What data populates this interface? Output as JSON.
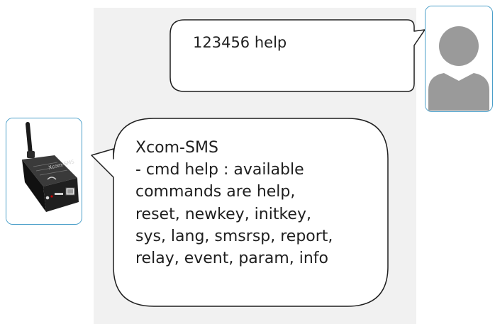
{
  "conversation": {
    "user_message": "123456 help",
    "device_reply": {
      "lines": [
        "Xcom-SMS",
        "- cmd help : available",
        "commands are help,",
        "reset, newkey, initkey,",
        "sys, lang, smsrsp, report,",
        "relay, event, param, info"
      ]
    }
  },
  "device_label": "Xcom-SMS",
  "icons": {
    "user": "person-avatar-icon",
    "device": "gsm-modem-device-icon"
  },
  "colors": {
    "panel_background": "#f1f1f1",
    "bubble_fill": "#ffffff",
    "bubble_border": "#1f1f1f",
    "avatar_border": "#4b9fc9",
    "avatar_silhouette": "#9a9a9a",
    "text": "#1f1f1f"
  }
}
